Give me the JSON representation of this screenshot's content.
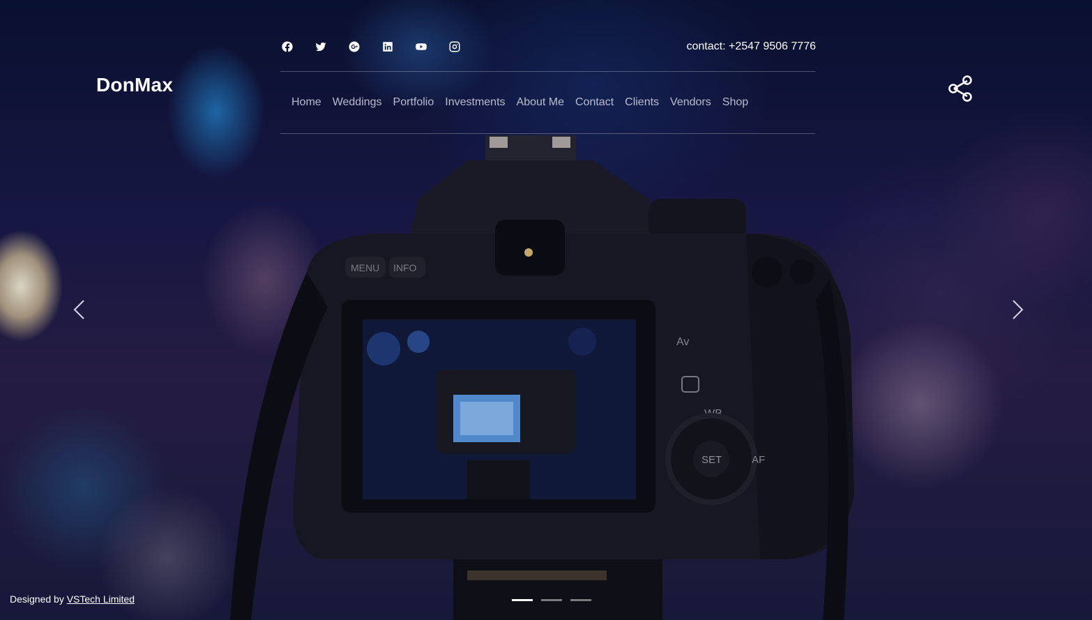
{
  "brand": {
    "name": "DonMax"
  },
  "header": {
    "contact": "contact: +2547 9506 7776",
    "social_icons": [
      "facebook-icon",
      "twitter-icon",
      "google-plus-icon",
      "linkedin-icon",
      "youtube-icon",
      "instagram-icon"
    ]
  },
  "nav": {
    "items": [
      {
        "label": "Home"
      },
      {
        "label": "Weddings"
      },
      {
        "label": "Portfolio"
      },
      {
        "label": "Investments"
      },
      {
        "label": "About Me"
      },
      {
        "label": "Contact"
      },
      {
        "label": "Clients"
      },
      {
        "label": "Vendors"
      },
      {
        "label": "Shop"
      }
    ]
  },
  "share": {
    "icon": "share-icon"
  },
  "carousel": {
    "prev_icon": "chevron-left-icon",
    "next_icon": "chevron-right-icon",
    "slide_count": 3,
    "active_slide": 1
  },
  "camera_labels": {
    "menu": "MENU",
    "info": "INFO",
    "av": "Av",
    "wb": "WB",
    "set": "SET",
    "af": "AF"
  },
  "footer": {
    "prefix": "Designed by ",
    "link_text": "VSTech Limited"
  },
  "colors": {
    "background": "#1a1a4a",
    "text": "#ffffff",
    "nav_text": "#d7d7e6"
  }
}
